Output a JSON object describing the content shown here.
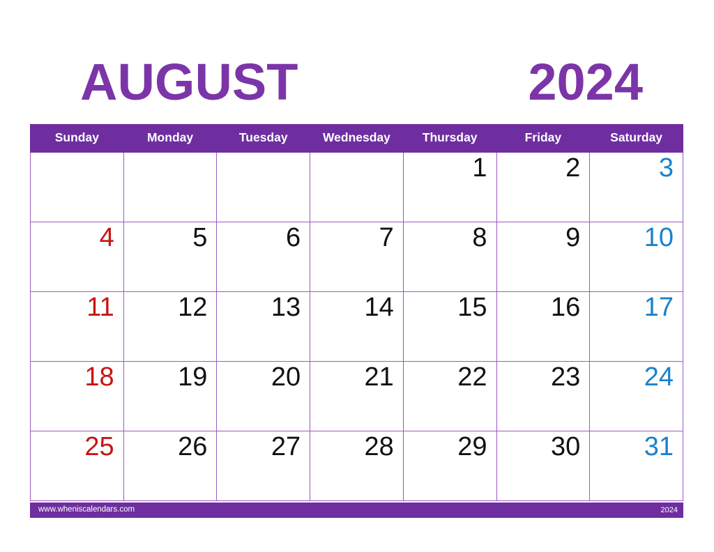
{
  "header": {
    "month": "AUGUST",
    "year": "2024"
  },
  "colors": {
    "header_purple": "#6e2ea0",
    "title_purple": "#7b35a8",
    "grid_purple": "#9a59c4",
    "sunday_red": "#c81414",
    "saturday_blue": "#1a81cc",
    "weekday_black": "#111111",
    "page_background": "#ffffff"
  },
  "calendar": {
    "weekday_headers": [
      "Sunday",
      "Monday",
      "Tuesday",
      "Wednesday",
      "Thursday",
      "Friday",
      "Saturday"
    ],
    "weeks": [
      [
        {
          "day": "",
          "kind": "empty"
        },
        {
          "day": "",
          "kind": "empty"
        },
        {
          "day": "",
          "kind": "empty"
        },
        {
          "day": "",
          "kind": "empty"
        },
        {
          "day": "1",
          "kind": "weekday"
        },
        {
          "day": "2",
          "kind": "weekday"
        },
        {
          "day": "3",
          "kind": "saturday"
        }
      ],
      [
        {
          "day": "4",
          "kind": "sunday"
        },
        {
          "day": "5",
          "kind": "weekday"
        },
        {
          "day": "6",
          "kind": "weekday"
        },
        {
          "day": "7",
          "kind": "weekday"
        },
        {
          "day": "8",
          "kind": "weekday"
        },
        {
          "day": "9",
          "kind": "weekday"
        },
        {
          "day": "10",
          "kind": "saturday"
        }
      ],
      [
        {
          "day": "11",
          "kind": "sunday"
        },
        {
          "day": "12",
          "kind": "weekday"
        },
        {
          "day": "13",
          "kind": "weekday"
        },
        {
          "day": "14",
          "kind": "weekday"
        },
        {
          "day": "15",
          "kind": "weekday"
        },
        {
          "day": "16",
          "kind": "weekday"
        },
        {
          "day": "17",
          "kind": "saturday"
        }
      ],
      [
        {
          "day": "18",
          "kind": "sunday"
        },
        {
          "day": "19",
          "kind": "weekday"
        },
        {
          "day": "20",
          "kind": "weekday"
        },
        {
          "day": "21",
          "kind": "weekday"
        },
        {
          "day": "22",
          "kind": "weekday"
        },
        {
          "day": "23",
          "kind": "weekday"
        },
        {
          "day": "24",
          "kind": "saturday"
        }
      ],
      [
        {
          "day": "25",
          "kind": "sunday"
        },
        {
          "day": "26",
          "kind": "weekday"
        },
        {
          "day": "27",
          "kind": "weekday"
        },
        {
          "day": "28",
          "kind": "weekday"
        },
        {
          "day": "29",
          "kind": "weekday"
        },
        {
          "day": "30",
          "kind": "weekday"
        },
        {
          "day": "31",
          "kind": "saturday"
        }
      ]
    ]
  },
  "footer": {
    "url": "www.wheniscalendars.com",
    "year": "2024"
  }
}
